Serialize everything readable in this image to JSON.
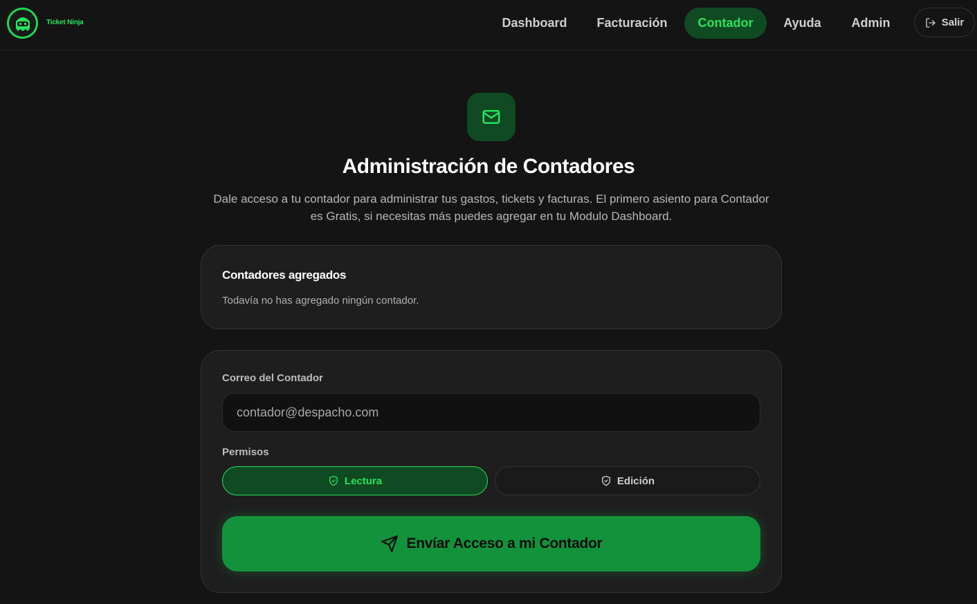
{
  "header": {
    "brand": "Ticket Ninja",
    "nav": [
      {
        "label": "Dashboard"
      },
      {
        "label": "Facturación"
      },
      {
        "label": "Contador"
      },
      {
        "label": "Ayuda"
      },
      {
        "label": "Admin"
      }
    ],
    "active_nav": "Contador",
    "logout_label": "Salir"
  },
  "hero": {
    "icon": "mail-icon",
    "title": "Administración de Contadores",
    "description": "Dale acceso a tu contador para administrar tus gastos, tickets y facturas. El primero asiento para Contador es Gratis, si necesitas más puedes agregar en tu Modulo Dashboard."
  },
  "accountants": {
    "title": "Contadores agregados",
    "empty_message": "Todavía no has agregado ningún contador."
  },
  "form": {
    "email_label": "Correo del Contador",
    "email_placeholder": "contador@despacho.com",
    "permissions_label": "Permisos",
    "permissions": [
      {
        "label": "Lectura",
        "selected": true
      },
      {
        "label": "Edición",
        "selected": false
      }
    ],
    "submit_label": "Envíar Acceso a mi Contador"
  },
  "colors": {
    "accent": "#27e35c",
    "accent_bg": "#0f4a22",
    "button": "#12933b",
    "background": "#141414",
    "card": "#1e1e1e"
  }
}
